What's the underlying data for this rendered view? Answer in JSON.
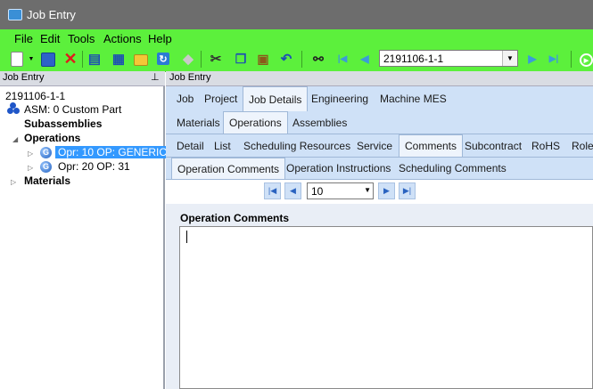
{
  "window": {
    "title": "Job Entry"
  },
  "menu": [
    "File",
    "Edit",
    "Tools",
    "Actions",
    "Help"
  ],
  "toolbar": {
    "job_number": "2191106-1-1"
  },
  "left_panel": {
    "header": "Job Entry",
    "pin_glyph": "📌",
    "tree": {
      "job": "2191106-1-1",
      "asm": "ASM: 0 Custom Part",
      "subassemblies": "Subassemblies",
      "operations": "Operations",
      "op1": "Opr: 10 OP: GENERIC",
      "op2": "Opr: 20 OP: 31",
      "materials": "Materials"
    }
  },
  "right_panel": {
    "header": "Job Entry",
    "tabs1": [
      "Job",
      "Project",
      "Job Details",
      "Engineering",
      "Machine MES"
    ],
    "tabs2": [
      "Materials",
      "Operations",
      "Assemblies"
    ],
    "tabs3": [
      "Detail",
      "List",
      "Scheduling Resources",
      "Service",
      "Comments",
      "Subcontract",
      "RoHS",
      "Role"
    ],
    "tabs4": [
      "Operation Comments",
      "Operation Instructions",
      "Scheduling Comments"
    ],
    "nav_value": "10",
    "comments_label": "Operation Comments"
  },
  "icons": {
    "new": "new-document-icon",
    "save": "save-icon",
    "delete": "delete-icon",
    "open": "book-icon",
    "grid": "grid-icon",
    "folder": "folder-icon",
    "refresh": "refresh-icon",
    "eraser": "eraser-icon",
    "cut": "cut-icon",
    "copy": "copy-icon",
    "paste": "paste-icon",
    "undo": "undo-icon",
    "find": "binoculars-icon"
  },
  "colors": {
    "menubar": "#5cf03c",
    "titlebar": "#6d6d6d",
    "tab_bg": "#cfe1f7",
    "selection": "#3399ff"
  }
}
